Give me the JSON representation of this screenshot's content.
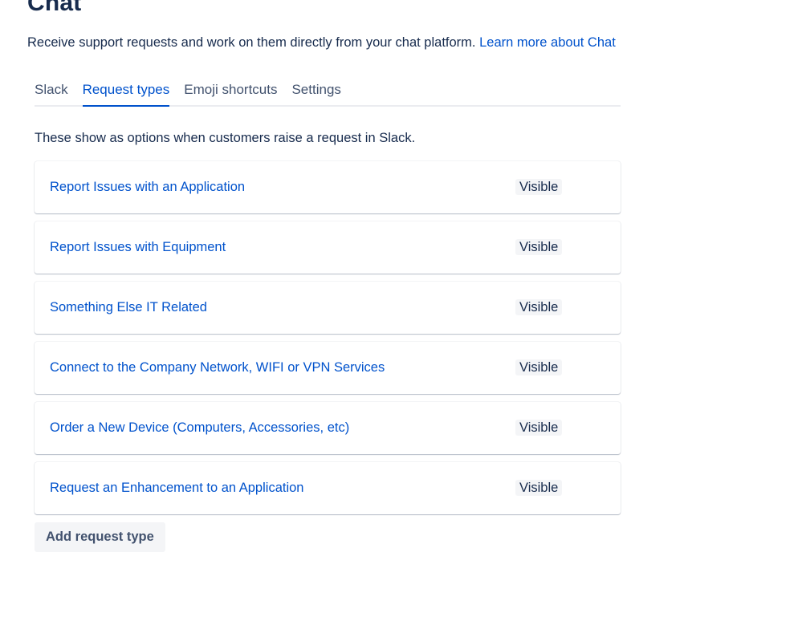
{
  "page": {
    "title": "Chat",
    "description": "Receive support requests and work on them directly from your chat platform.",
    "learn_more_link": "Learn more about Chat"
  },
  "tabs": [
    {
      "label": "Slack",
      "active": false
    },
    {
      "label": "Request types",
      "active": true
    },
    {
      "label": "Emoji shortcuts",
      "active": false
    },
    {
      "label": "Settings",
      "active": false
    }
  ],
  "request_types": {
    "intro": "These show as options when customers raise a request in Slack.",
    "items": [
      {
        "name": "Report Issues with an Application",
        "status": "Visible"
      },
      {
        "name": "Report Issues with Equipment",
        "status": "Visible"
      },
      {
        "name": "Something Else IT Related",
        "status": "Visible"
      },
      {
        "name": "Connect to the Company Network, WIFI or VPN Services",
        "status": "Visible"
      },
      {
        "name": "Order a New Device (Computers, Accessories, etc)",
        "status": "Visible"
      },
      {
        "name": "Request an Enhancement to an Application",
        "status": "Visible"
      }
    ],
    "add_button_label": "Add request type"
  },
  "colors": {
    "text": "#172b4d",
    "link": "#0052cc",
    "tab_inactive": "#42526e",
    "lozenge_bg": "#f4f5f7",
    "tab_divider": "#ebecf0"
  }
}
